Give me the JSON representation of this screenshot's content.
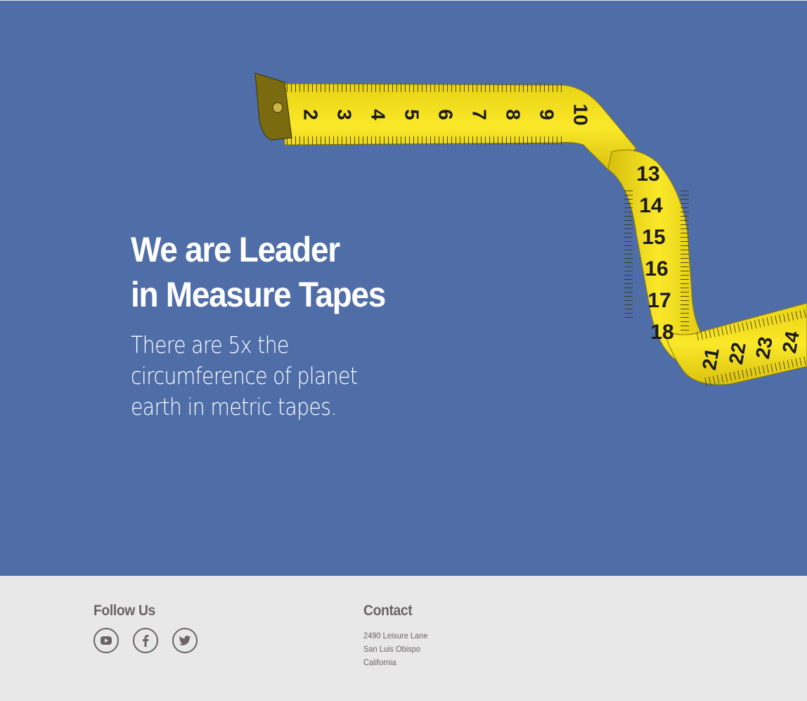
{
  "hero": {
    "title_line1": "We are Leader",
    "title_line2": "in Measure Tapes",
    "subtitle": "There are 5x the circumference of planet earth in metric tapes.",
    "background_color": "#4f6ea8",
    "image": {
      "icon": "measuring-tape-image",
      "tape_color": "#f5e11e",
      "numbers_top": [
        "2",
        "3",
        "4",
        "5",
        "6",
        "7",
        "8",
        "9",
        "10"
      ],
      "numbers_side": [
        "13",
        "14",
        "15",
        "16",
        "17",
        "18"
      ],
      "numbers_bottom": [
        "21",
        "22",
        "23",
        "24"
      ]
    }
  },
  "footer": {
    "follow": {
      "heading": "Follow Us",
      "icons": [
        "youtube-icon",
        "facebook-icon",
        "twitter-icon"
      ]
    },
    "contact": {
      "heading": "Contact",
      "address_line1": "2490 Leisure Lane",
      "address_line2": "San Luis Obispo",
      "address_line3": "California"
    },
    "text_color": "#6b6365"
  }
}
